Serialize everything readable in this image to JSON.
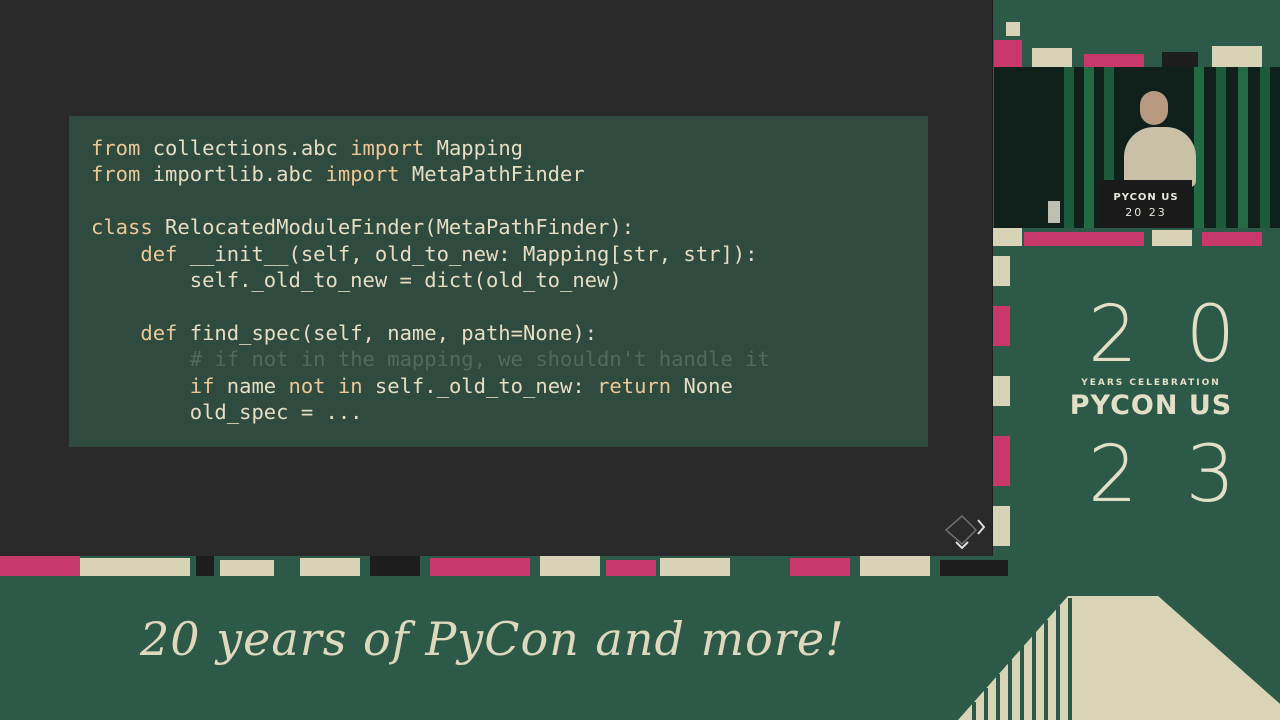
{
  "slide": {
    "code_lines": [
      [
        {
          "t": "from",
          "k": "kw"
        },
        {
          "t": " collections.abc ",
          "k": ""
        },
        {
          "t": "import",
          "k": "kw"
        },
        {
          "t": " Mapping",
          "k": ""
        }
      ],
      [
        {
          "t": "from",
          "k": "kw"
        },
        {
          "t": " importlib.abc ",
          "k": ""
        },
        {
          "t": "import",
          "k": "kw"
        },
        {
          "t": " MetaPathFinder",
          "k": ""
        }
      ],
      [],
      [
        {
          "t": "class",
          "k": "kw"
        },
        {
          "t": " RelocatedModuleFinder(MetaPathFinder):",
          "k": ""
        }
      ],
      [
        {
          "t": "    ",
          "k": ""
        },
        {
          "t": "def",
          "k": "kw"
        },
        {
          "t": " __init__(self, old_to_new: Mapping[str, str]):",
          "k": ""
        }
      ],
      [
        {
          "t": "        self._old_to_new = dict(old_to_new)",
          "k": ""
        }
      ],
      [],
      [
        {
          "t": "    ",
          "k": ""
        },
        {
          "t": "def",
          "k": "kw"
        },
        {
          "t": " find_spec(self, name, path=None):",
          "k": ""
        }
      ],
      [
        {
          "t": "        ",
          "k": ""
        },
        {
          "t": "# if not in the mapping, we shouldn't handle it",
          "k": "cm"
        }
      ],
      [
        {
          "t": "        ",
          "k": ""
        },
        {
          "t": "if",
          "k": "kw"
        },
        {
          "t": " name ",
          "k": ""
        },
        {
          "t": "not",
          "k": "kw"
        },
        {
          "t": " ",
          "k": ""
        },
        {
          "t": "in",
          "k": "kw"
        },
        {
          "t": " self._old_to_new: ",
          "k": ""
        },
        {
          "t": "return",
          "k": "kw"
        },
        {
          "t": " None",
          "k": ""
        }
      ],
      [
        {
          "t": "        old_spec = ...",
          "k": ""
        }
      ]
    ]
  },
  "video": {
    "podium_label": "PYCON US",
    "podium_year": "20 23"
  },
  "logo": {
    "top_digits": "20",
    "subtitle": "YEARS CELEBRATION",
    "name": "PYCON US",
    "bottom_digits": "23"
  },
  "banner": {
    "tagline": "20 years of PyCon and more!"
  },
  "colors": {
    "background": "#2d5a48",
    "slide_bg": "#2a2a2a",
    "code_panel": "#2f4a3f",
    "code_text": "#e6ddc2",
    "keyword": "#ecc896",
    "comment": "#4f6b5d",
    "accent_pink": "#c8386a",
    "cream": "#e3dfc7"
  },
  "icons": {
    "nav": "chevron-right-icon"
  }
}
